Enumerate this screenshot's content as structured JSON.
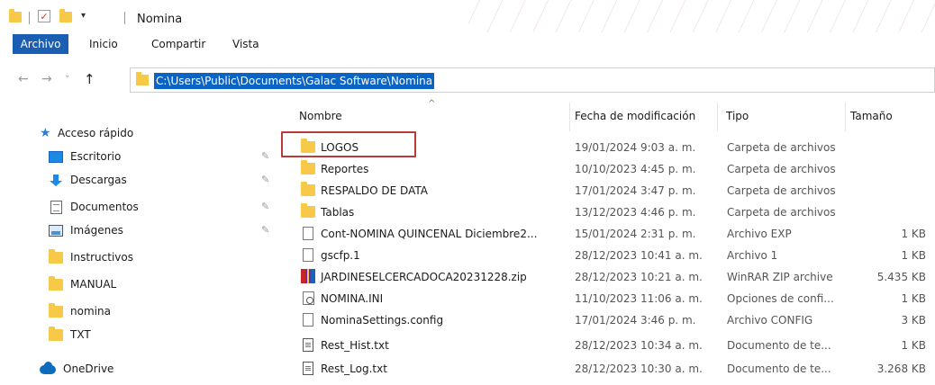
{
  "window": {
    "title": "Nomina",
    "quick_access_arrow": "▾",
    "check_glyph": "✓"
  },
  "ribbon": {
    "tabs": [
      {
        "label": "Archivo",
        "active": true
      },
      {
        "label": "Inicio"
      },
      {
        "label": "Compartir"
      },
      {
        "label": "Vista"
      }
    ]
  },
  "nav": {
    "back_glyph": "←",
    "forward_glyph": "→",
    "recent_glyph": "˅",
    "up_glyph": "↑",
    "address": "C:\\Users\\Public\\Documents\\Galac Software\\Nomina"
  },
  "sidebar": {
    "items": [
      {
        "label": "Acceso rápido",
        "icon": "star-icon",
        "pinned": false
      },
      {
        "label": "Escritorio",
        "icon": "desktop-icon",
        "pinned": true
      },
      {
        "label": "Descargas",
        "icon": "download-icon",
        "pinned": true
      },
      {
        "label": "Documentos",
        "icon": "documents-icon",
        "pinned": true
      },
      {
        "label": "Imágenes",
        "icon": "pictures-icon",
        "pinned": true
      },
      {
        "label": "Instructivos",
        "icon": "folder-icon",
        "pinned": false
      },
      {
        "label": "MANUAL",
        "icon": "folder-icon",
        "pinned": false
      },
      {
        "label": "nomina",
        "icon": "folder-icon",
        "pinned": false
      },
      {
        "label": "TXT",
        "icon": "folder-icon",
        "pinned": false
      },
      {
        "label": "OneDrive",
        "icon": "cloud-icon",
        "pinned": false
      }
    ],
    "pin_glyph": "📌"
  },
  "columns": {
    "name": "Nombre",
    "date": "Fecha de modificación",
    "type": "Tipo",
    "size": "Tamaño",
    "sort_glyph": "^"
  },
  "files": [
    {
      "name": "LOGOS",
      "date": "19/01/2024 9:03 a. m.",
      "type": "Carpeta de archivos",
      "size": "",
      "icon": "folder-icon",
      "highlighted": true
    },
    {
      "name": "Reportes",
      "date": "10/10/2023 4:45 p. m.",
      "type": "Carpeta de archivos",
      "size": "",
      "icon": "folder-icon"
    },
    {
      "name": "RESPALDO DE DATA",
      "date": "17/01/2024 3:47 p. m.",
      "type": "Carpeta de archivos",
      "size": "",
      "icon": "folder-icon"
    },
    {
      "name": "Tablas",
      "date": "13/12/2023 4:46 p. m.",
      "type": "Carpeta de archivos",
      "size": "",
      "icon": "folder-icon"
    },
    {
      "name": "Cont-NOMINA QUINCENAL Diciembre2...",
      "date": "15/01/2024 2:31 p. m.",
      "type": "Archivo EXP",
      "size": "1 KB",
      "icon": "file-icon"
    },
    {
      "name": "gscfp.1",
      "date": "28/12/2023 10:41 a. m.",
      "type": "Archivo 1",
      "size": "1 KB",
      "icon": "file-icon"
    },
    {
      "name": "JARDINESELCERCADOCA20231228.zip",
      "date": "28/12/2023 10:21 a. m.",
      "type": "WinRAR ZIP archive",
      "size": "5.435 KB",
      "icon": "zip-icon"
    },
    {
      "name": "NOMINA.INI",
      "date": "11/10/2023 11:06 a. m.",
      "type": "Opciones de confi...",
      "size": "1 KB",
      "icon": "settings-file-icon"
    },
    {
      "name": "NominaSettings.config",
      "date": "17/01/2024 3:46 p. m.",
      "type": "Archivo CONFIG",
      "size": "3 KB",
      "icon": "file-icon"
    },
    {
      "name": "Rest_Hist.txt",
      "date": "28/12/2023 10:34 a. m.",
      "type": "Documento de te...",
      "size": "1 KB",
      "icon": "text-file-icon"
    },
    {
      "name": "Rest_Log.txt",
      "date": "28/12/2023 10:30 a. m.",
      "type": "Documento de te...",
      "size": "3.268 KB",
      "icon": "text-file-icon"
    }
  ],
  "colors": {
    "accent": "#1a5fb4",
    "selection": "#0b64c4",
    "folder": "#f7c948",
    "highlight_box": "#b83b3b"
  }
}
